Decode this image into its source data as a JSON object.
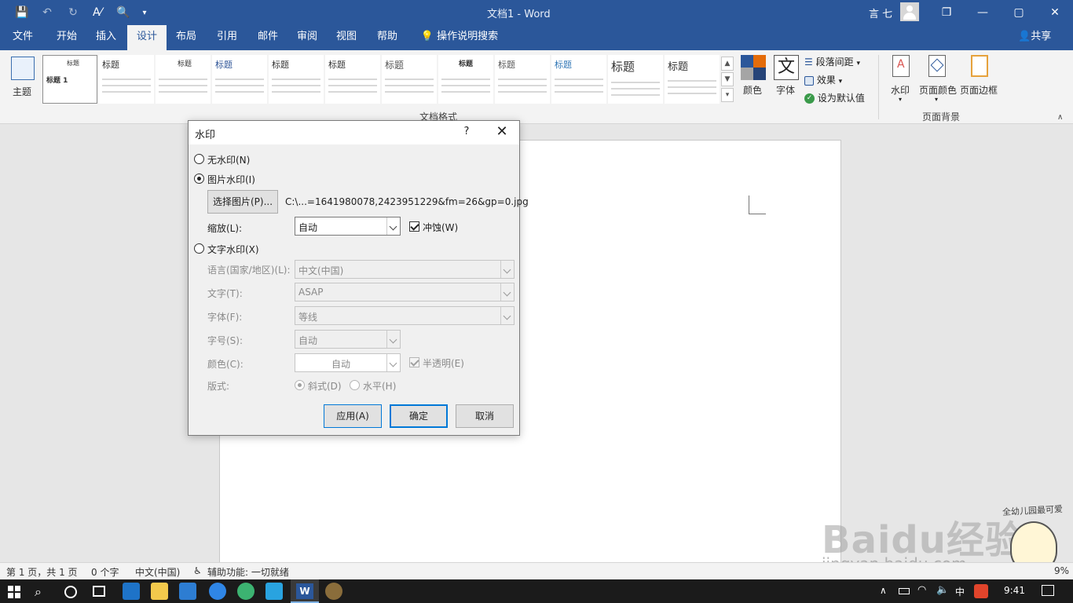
{
  "window": {
    "doc_title": "文档1  -  Word",
    "user_name": "言 七",
    "restore_symbol": "❐",
    "maximize_symbol": "▢",
    "close_symbol": "✕",
    "minimize_symbol": "—"
  },
  "quick_access": {
    "save_icon": "💾",
    "undo_icon": "↶",
    "redo_icon": "↻",
    "format_icon": "A⁄",
    "preview_icon": "🔍",
    "customize_icon": "▾"
  },
  "tabs": [
    {
      "label": "文件"
    },
    {
      "label": "开始"
    },
    {
      "label": "插入"
    },
    {
      "label": "设计"
    },
    {
      "label": "布局"
    },
    {
      "label": "引用"
    },
    {
      "label": "邮件"
    },
    {
      "label": "审阅"
    },
    {
      "label": "视图"
    },
    {
      "label": "帮助"
    },
    {
      "label": "操作说明搜索"
    }
  ],
  "share_label": "共享",
  "ribbon": {
    "theme_label": "主题",
    "gallery_title_top": "标题",
    "gallery_heading": "标题 1",
    "gallery": [
      {
        "title": "标题"
      },
      {
        "title": "标题"
      },
      {
        "title": "标题"
      },
      {
        "title": "标题"
      },
      {
        "title": "标题"
      },
      {
        "title": "标题"
      },
      {
        "title": "标题"
      },
      {
        "title": "标题"
      },
      {
        "title": "标题"
      },
      {
        "title": "标题"
      },
      {
        "title": "标题"
      }
    ],
    "colors_label": "颜色",
    "fonts_label": "字体",
    "fonts_glyph": "文",
    "paragraph_spacing_label": "段落间距",
    "effects_label": "效果",
    "set_default_label": "设为默认值",
    "doc_format_group": "文档格式",
    "watermark_label": "水印",
    "page_color_label": "页面颜色",
    "page_border_label": "页面边框",
    "page_background_group": "页面背景"
  },
  "status": {
    "page_info": "第 1 页，共 1 页",
    "word_count": "0 个字",
    "language": "中文(中国)",
    "accessibility": "辅助功能: 一切就绪",
    "zoom": "9%"
  },
  "taskbar": {
    "ime_lang": "中",
    "time": "9:41"
  },
  "dialog": {
    "title": "水印",
    "help": "?",
    "close": "✕",
    "no_watermark": "无水印(N)",
    "picture_watermark": "图片水印(I)",
    "select_picture_button": "选择图片(P)...",
    "picture_path": "C:\\...=1641980078,2423951229&fm=26&gp=0.jpg",
    "scale_label": "缩放(L):",
    "scale_value": "自动",
    "washout_label": "冲蚀(W)",
    "text_watermark": "文字水印(X)",
    "language_label": "语言(国家/地区)(L):",
    "language_value": "中文(中国)",
    "text_label": "文字(T):",
    "text_value": "ASAP",
    "font_label": "字体(F):",
    "font_value": "等线",
    "size_label": "字号(S):",
    "size_value": "自动",
    "color_label": "颜色(C):",
    "color_value": "自动",
    "semitransparent_label": "半透明(E)",
    "layout_label": "版式:",
    "diagonal_label": "斜式(D)",
    "horizontal_label": "水平(H)",
    "apply_button": "应用(A)",
    "ok_button": "确定",
    "cancel_button": "取消",
    "selected": "picture",
    "washout_checked": true,
    "semitransparent_checked": true
  },
  "watermark_overlay": {
    "brand": "Baidu经验",
    "url": "jingyan.baidu.com",
    "tagline": "全幼儿园最可爱"
  },
  "colors": {
    "accent": "#2b579a",
    "ok_border": "#0078d7"
  }
}
